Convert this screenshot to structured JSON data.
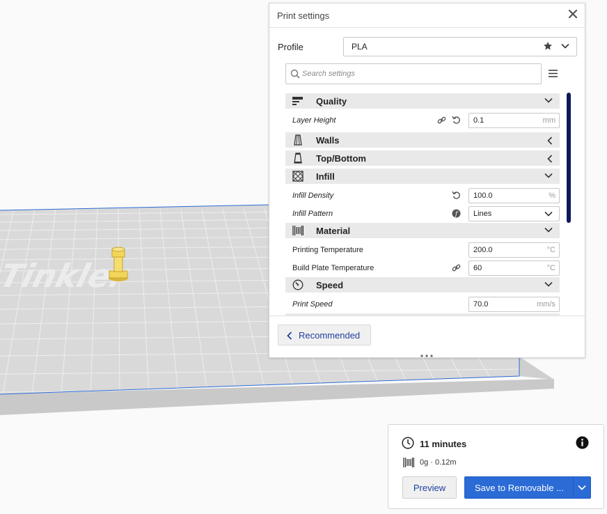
{
  "viewport": {
    "bed_logo_text": "Tinkler"
  },
  "print_settings": {
    "title": "Print settings",
    "profile_label": "Profile",
    "profile_value": "PLA",
    "search_placeholder": "Search settings",
    "categories": {
      "quality": "Quality",
      "walls": "Walls",
      "top_bottom": "Top/Bottom",
      "infill": "Infill",
      "material": "Material",
      "speed": "Speed"
    },
    "settings": {
      "layer_height": {
        "label": "Layer Height",
        "value": "0.1",
        "unit": "mm"
      },
      "infill_density": {
        "label": "Infill Density",
        "value": "100.0",
        "unit": "%"
      },
      "infill_pattern": {
        "label": "Infill Pattern",
        "value": "Lines"
      },
      "printing_temperature": {
        "label": "Printing Temperature",
        "value": "200.0",
        "unit": "°C"
      },
      "build_plate_temperature": {
        "label": "Build Plate Temperature",
        "value": "60",
        "unit": "°C"
      },
      "print_speed": {
        "label": "Print Speed",
        "value": "70.0",
        "unit": "mm/s"
      }
    },
    "recommended_label": "Recommended"
  },
  "output": {
    "time": "11 minutes",
    "material": "0g · 0.12m",
    "preview_label": "Preview",
    "save_label": "Save to Removable ..."
  },
  "colors": {
    "accent": "#2a6bd6",
    "scrollbar": "#0d1a5a",
    "model": "#f2d65a",
    "bed_border": "#2a6bd6"
  }
}
